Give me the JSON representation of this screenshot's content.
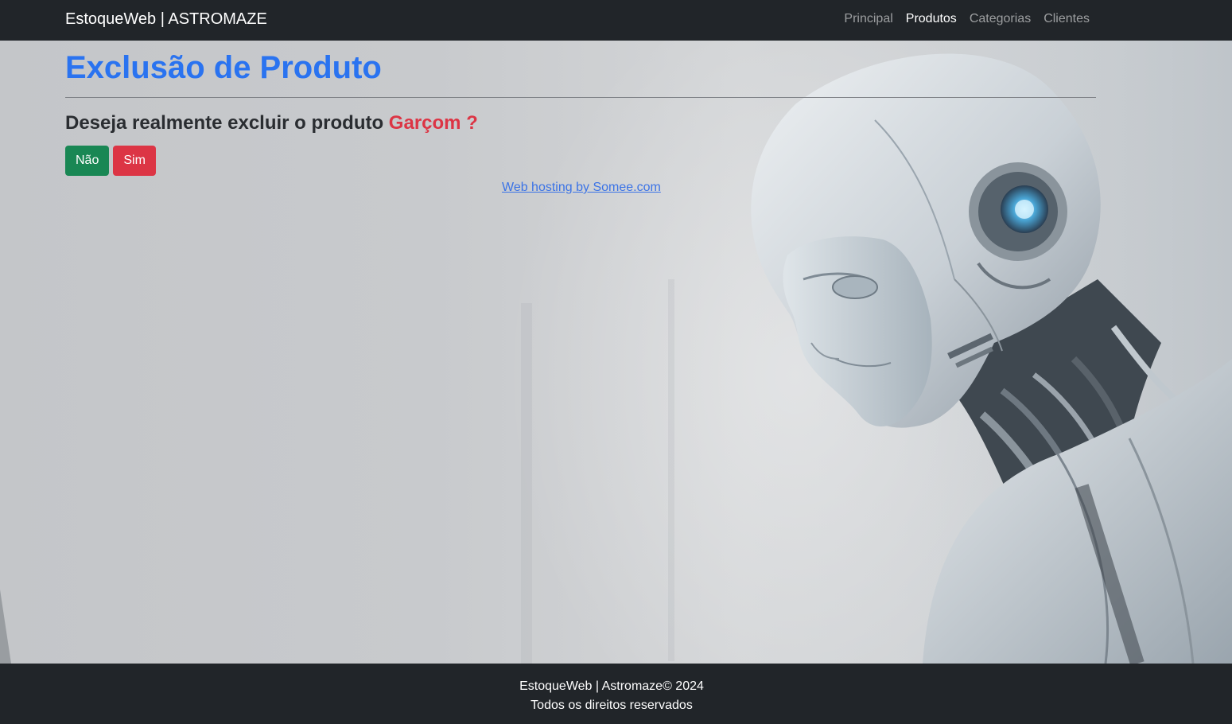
{
  "navbar": {
    "brand": "EstoqueWeb | ASTROMAZE",
    "links": [
      {
        "label": "Principal",
        "active": false
      },
      {
        "label": "Produtos",
        "active": true
      },
      {
        "label": "Categorias",
        "active": false
      },
      {
        "label": "Clientes",
        "active": false
      }
    ]
  },
  "main": {
    "title": "Exclusão de Produto",
    "question_prefix": "Deseja realmente excluir o produto",
    "product_name": "Garçom ?",
    "buttons": {
      "no_label": "Não",
      "yes_label": "Sim"
    },
    "hosting_link": "Web hosting by Somee.com"
  },
  "footer": {
    "line1": "EstoqueWeb | Astromaze© 2024",
    "line2": "Todos os direitos reservados"
  },
  "colors": {
    "navbar_bg": "#212529",
    "title": "#2a73f0",
    "danger": "#dc3545",
    "success": "#198754"
  }
}
